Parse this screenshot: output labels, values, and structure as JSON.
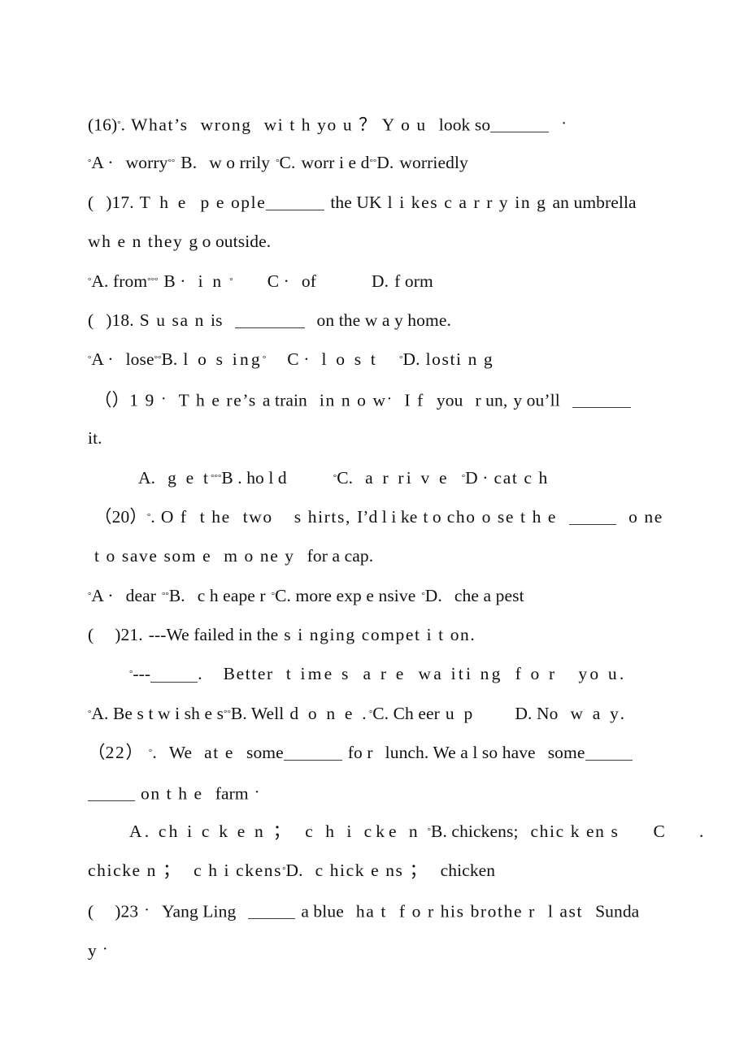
{
  "document": {
    "type": "english-grammar-worksheet",
    "page_background": "#ffffff",
    "text_color": "#111111",
    "separator_glyph": "°",
    "middot_glyph": "·",
    "questions": [
      {
        "number": "(16)",
        "stem_lines": [
          "(16)°. What’s  wrong  with you ？  You  look so ______ ·"
        ],
        "options_lines": [
          "°A ·  worry°° B.   worrily °C. worr i e d°°D. worriedly"
        ],
        "options": [
          "A. worry",
          "B. worrily",
          "C. worried",
          "D. worriedly"
        ]
      },
      {
        "number": "( )17.",
        "stem_lines": [
          "( )17.  The   people ______ the UK likes carrying  an umbrella",
          "when they  go outside."
        ],
        "options_lines": [
          "°A. from°°° B ·  i n °    C ·  of        D.  f orm"
        ],
        "options": [
          "A. from",
          "B. in",
          "C. of",
          "D. form"
        ]
      },
      {
        "number": "( )18.",
        "stem_lines": [
          "( )18. Susan  is  ________ on the way home."
        ],
        "options_lines": [
          "°A ·  lose°°B.  l o s ing°   C ·  l o s t    °D.  losti n g"
        ],
        "options": [
          "A. lose",
          "B. losing",
          "C. lost",
          "D. losting"
        ]
      },
      {
        "number": "（ ）19 ·",
        "stem_lines": [
          "（ ）19 ·  There’s a train  in now ·  I f  you  r un,  you’ll  _______",
          "it."
        ],
        "options_lines": [
          "A.  ge t°°°B. ho l d     °C.  a r ri v e   °D ·  cat c h"
        ],
        "options": [
          "A. get",
          "B. hold",
          "C. arrive",
          "D. catch"
        ]
      },
      {
        "number": "（20）",
        "stem_lines": [
          "（20）°. O f  the  two   s hirts, I’d like to  choose the  ____  o ne",
          "t o save som e  m o ne y  for a cap."
        ],
        "options_lines": [
          "°A ·  dear °°B.  c h eape r  °C. more exp e nsive °D.  che a pest"
        ],
        "options": [
          "A. dear",
          "B. cheaper",
          "C. more expensive",
          "D. cheapest"
        ]
      },
      {
        "number": "( )21.",
        "stem_lines": [
          "(   )21. ---We failed in the s i nging compet i t on.",
          "°---_____.  Better  t ime s  a r e  wa iti ng  f o r  yo u."
        ],
        "options_lines": [
          "°A. Be s t w i sh e s°°B. Well  d o n e .°C. Ch eer  u p     D. No  w a y."
        ],
        "options": [
          "A. Best wishes",
          "B. Well done.",
          "C. Cheer up",
          "D. No way."
        ]
      },
      {
        "number": "（22）",
        "stem_lines": [
          "（22）°.  We  at e   some ______ fo r  lunch. We a l so have  some ____",
          "_____ on t h e   farm ·"
        ],
        "options_lines": [
          "A. ch i c k e n ；  c h i cke n  °B. chickens;  chic k en s    C   .",
          "chicke n ；  c h i ckens° D.  c hick e ns ；  chicken"
        ],
        "options": [
          "A. chicken; chicken",
          "B. chickens; chickens",
          "C. chicken; chickens",
          "D. chickens; chicken"
        ]
      },
      {
        "number": "( )23 ·",
        "stem_lines": [
          "(   )23 ·   Yang Ling  _____ a blue   ha t  f o r his brothe r   l ast   Sunda",
          "y ·"
        ],
        "options_lines": [],
        "options": []
      }
    ],
    "lines": [
      {
        "id": "l01",
        "indent": 0,
        "text": "(16)°. What’s  wrong  with you ？  You  look so ______ ·"
      },
      {
        "id": "l02",
        "indent": 0,
        "text": "°A ·  worry°° B.   worrily °C. worr i e d°°D. worriedly"
      },
      {
        "id": "l03",
        "indent": 0,
        "text": "(   )17.  The   people ______ the UK likes carrying  an umbrella"
      },
      {
        "id": "l04",
        "indent": 0,
        "text": "when they  go outside."
      },
      {
        "id": "l05",
        "indent": 0,
        "text": "°A. from°°° B ·  i n °     C ·  of         D.  f orm"
      },
      {
        "id": "l06",
        "indent": 0,
        "text": "(   )18. Susan  is  ________ on the way home."
      },
      {
        "id": "l07",
        "indent": 0,
        "text": "°A ·  lose°°B.  l o s ing°   C ·  l o s t    °D.  losti n g"
      },
      {
        "id": "l08",
        "indent": 1,
        "text": "（ ）19 ·  There’s a train  in now ·  I f  you  r un,  you’ll  _______"
      },
      {
        "id": "l09",
        "indent": 0,
        "text": "it."
      },
      {
        "id": "l10",
        "indent": 2,
        "text": "A.  ge t°°°B. ho l d     °C.  a r ri v e   °D ·  cat c h"
      },
      {
        "id": "l11",
        "indent": 1,
        "text": "（20）°. O f  the  two   s hirts, I’d like to  choose the  ____  o ne"
      },
      {
        "id": "l12",
        "indent": 1,
        "text": "t o save som e  m o ne y  for a cap."
      },
      {
        "id": "l13",
        "indent": 0,
        "text": "°A ·  dear °°B.  c h eape r  °C. more exp e nsive °D.  che a pest"
      },
      {
        "id": "l14",
        "indent": 0,
        "text": "(   )21. ---We failed in the s i nging compet i t on."
      },
      {
        "id": "l15",
        "indent": 2,
        "text": "°---_____.  Better  t ime s  a r e  wa iti ng  f o r  yo u."
      },
      {
        "id": "l16",
        "indent": 0,
        "text": "°A. Be s t w i sh e s°°B. Well  d o n e .°C. Ch eer  u p     D. No  w a y."
      },
      {
        "id": "l17",
        "indent": 0,
        "text": "（22）°.  We  at e   some ______ fo r  lunch. We a l so have  some ____"
      },
      {
        "id": "l18",
        "indent": 0,
        "text": "_____ on t h e   farm ·"
      },
      {
        "id": "l19",
        "indent": 2,
        "text": "A. ch i c k e n ；  c h i cke n  °B. chickens;  chic k en s    C   ."
      },
      {
        "id": "l20",
        "indent": 0,
        "text": "chicke n ；  c h i ckens° D.  c hick e ns ；  chicken"
      },
      {
        "id": "l21",
        "indent": 0,
        "text": "(   )23 ·   Yang Ling  _____ a blue   ha t  f o r his brothe r   l ast   Sunda"
      },
      {
        "id": "l22",
        "indent": 0,
        "text": "y ·"
      }
    ]
  },
  "fragments": {
    "q16": {
      "num": "(16)",
      "sep": "°",
      "dot_after_num": ".",
      "t1": "What’s",
      "t2": "wrong",
      "t3": "wi t h",
      "t4": "yo u",
      "q": "？",
      "t5": "Y o u",
      "t6": "look so",
      "end": "·"
    },
    "q16opt": {
      "a_mark": "°",
      "a": "A ·",
      "a_txt": "worry",
      "s1": "°°",
      "b": "B.",
      "b_txt": "w o rrily",
      "s2": "°",
      "c": "C.",
      "c_txt": "worr i e d",
      "s3": "°°",
      "d": "D.",
      "d_txt": "worriedly"
    },
    "q17": {
      "open": "(",
      "close": ")17.",
      "t1": "T h e",
      "t2": "p e ople",
      "t3": "the UK",
      "t4": "l i kes",
      "t5": "c a r r y in g",
      "t6": "an umbrella",
      "l2": "wh e n they",
      "l2b": "g o outside."
    },
    "q17opt": {
      "a_mark": "°",
      "a": "A. from",
      "s1": "°°°",
      "b": "B ·",
      "b_txt": "i n",
      "s2": "°",
      "c": "C ·",
      "c_txt": "of",
      "d": "D.",
      "d_txt": "f orm"
    },
    "q18": {
      "open": "(",
      "close": ")18.",
      "t1": "S u sa n",
      "t2": "is",
      "t3": "on the w a y home."
    },
    "q18opt": {
      "a_mark": "°",
      "a": "A ·",
      "a_txt": "lose",
      "s1": "°°",
      "b": "B.",
      "b_txt": "l o s ing",
      "s2": "°",
      "c": "C ·",
      "c_txt": "l o s t",
      "s3": "°",
      "d": "D.",
      "d_txt": "losti n g"
    },
    "q19": {
      "open": "（",
      "close": "）",
      "num": "1 9",
      "dot": "·",
      "t1": "T h e re’s",
      "t2": "a train",
      "t3": "in n o w",
      "dot2": "·",
      "t4": "I f",
      "t5": "you",
      "t6": "r un,",
      "t7": "y ou’ll",
      "l2": "it."
    },
    "q19opt": {
      "a": "A.",
      "a_txt": "g e t",
      "s1": "°°°",
      "b": "B . ho l d",
      "s2": "°",
      "c": "C.",
      "c_txt": "a r ri v e",
      "s3": "°",
      "d": "D ·",
      "d_txt": "cat c h"
    },
    "q20": {
      "open": "（",
      "num": "20",
      "close": "）",
      "sep": "°",
      "dot": ".",
      "t1": "O f",
      "t2": "t he",
      "t3": "two",
      "t4": "s hirts,",
      "t5": "I’d l i ke",
      "t6": "t o",
      "t7": "cho o se",
      "t8": "t h e",
      "t9": "o ne",
      "l2a": "t o save som e",
      "l2b": "m o ne y",
      "l2c": "for a cap."
    },
    "q20opt": {
      "a_mark": "°",
      "a": "A ·",
      "a_txt": "dear",
      "s1": "°°",
      "b": "B.",
      "b_txt": "c h eape r",
      "s2": "°",
      "c": "C. more exp e nsive",
      "s3": "°",
      "d": "D.",
      "d_txt": "che a pest"
    },
    "q21": {
      "open": "(",
      "close": ")21.",
      "t1": "---We failed in the",
      "t2": "s i nging",
      "t3": "compet i t on.",
      "l2mark": "°",
      "l2dash": "---",
      "l2dot": ".",
      "l2a": "Better",
      "l2b": "t ime s",
      "l2c": "a r e",
      "l2d": "wa iti ng",
      "l2e": "f o r",
      "l2f": "yo u."
    },
    "q21opt": {
      "a_mark": "°",
      "a": "A. Be s t w i sh e s",
      "s1": "°°",
      "b": "B. Well",
      "b_txt": "d o n e .",
      "s2": "°",
      "c": "C. Ch eer",
      "c_txt": "u p",
      "d": "D. No",
      "d_txt": "w a y."
    },
    "q22": {
      "open": "（",
      "num": "22",
      "close": "）",
      "sep": "°",
      "dot": ".",
      "t1": "We",
      "t2": "at e",
      "t3": "some",
      "t4": "fo r",
      "t5": "lunch. We a l so have",
      "t6": "some",
      "l2": "on t h e",
      "l2b": "farm",
      "l2dot": "·"
    },
    "q22opt": {
      "a": "A. ch i c k e n ；",
      "a2": "c h i cke n",
      "s1": "°",
      "b": "B. chickens;",
      "b2": "chic k en s",
      "c": "C",
      "c_dot": ".",
      "c2": "chicke n ；",
      "c3": "c h i ckens",
      "s2": "°",
      "d": "D.",
      "d2": "c hick e ns ；",
      "d3": "chicken"
    },
    "q23": {
      "open": "(",
      "close": ")23",
      "dot": "·",
      "t1": "Yang Ling",
      "t2": "a blue",
      "t3": "ha t",
      "t4": "f o r his brothe r",
      "t5": "l ast",
      "t6": "Sunda",
      "l2": "y",
      "l2dot": "·"
    }
  }
}
